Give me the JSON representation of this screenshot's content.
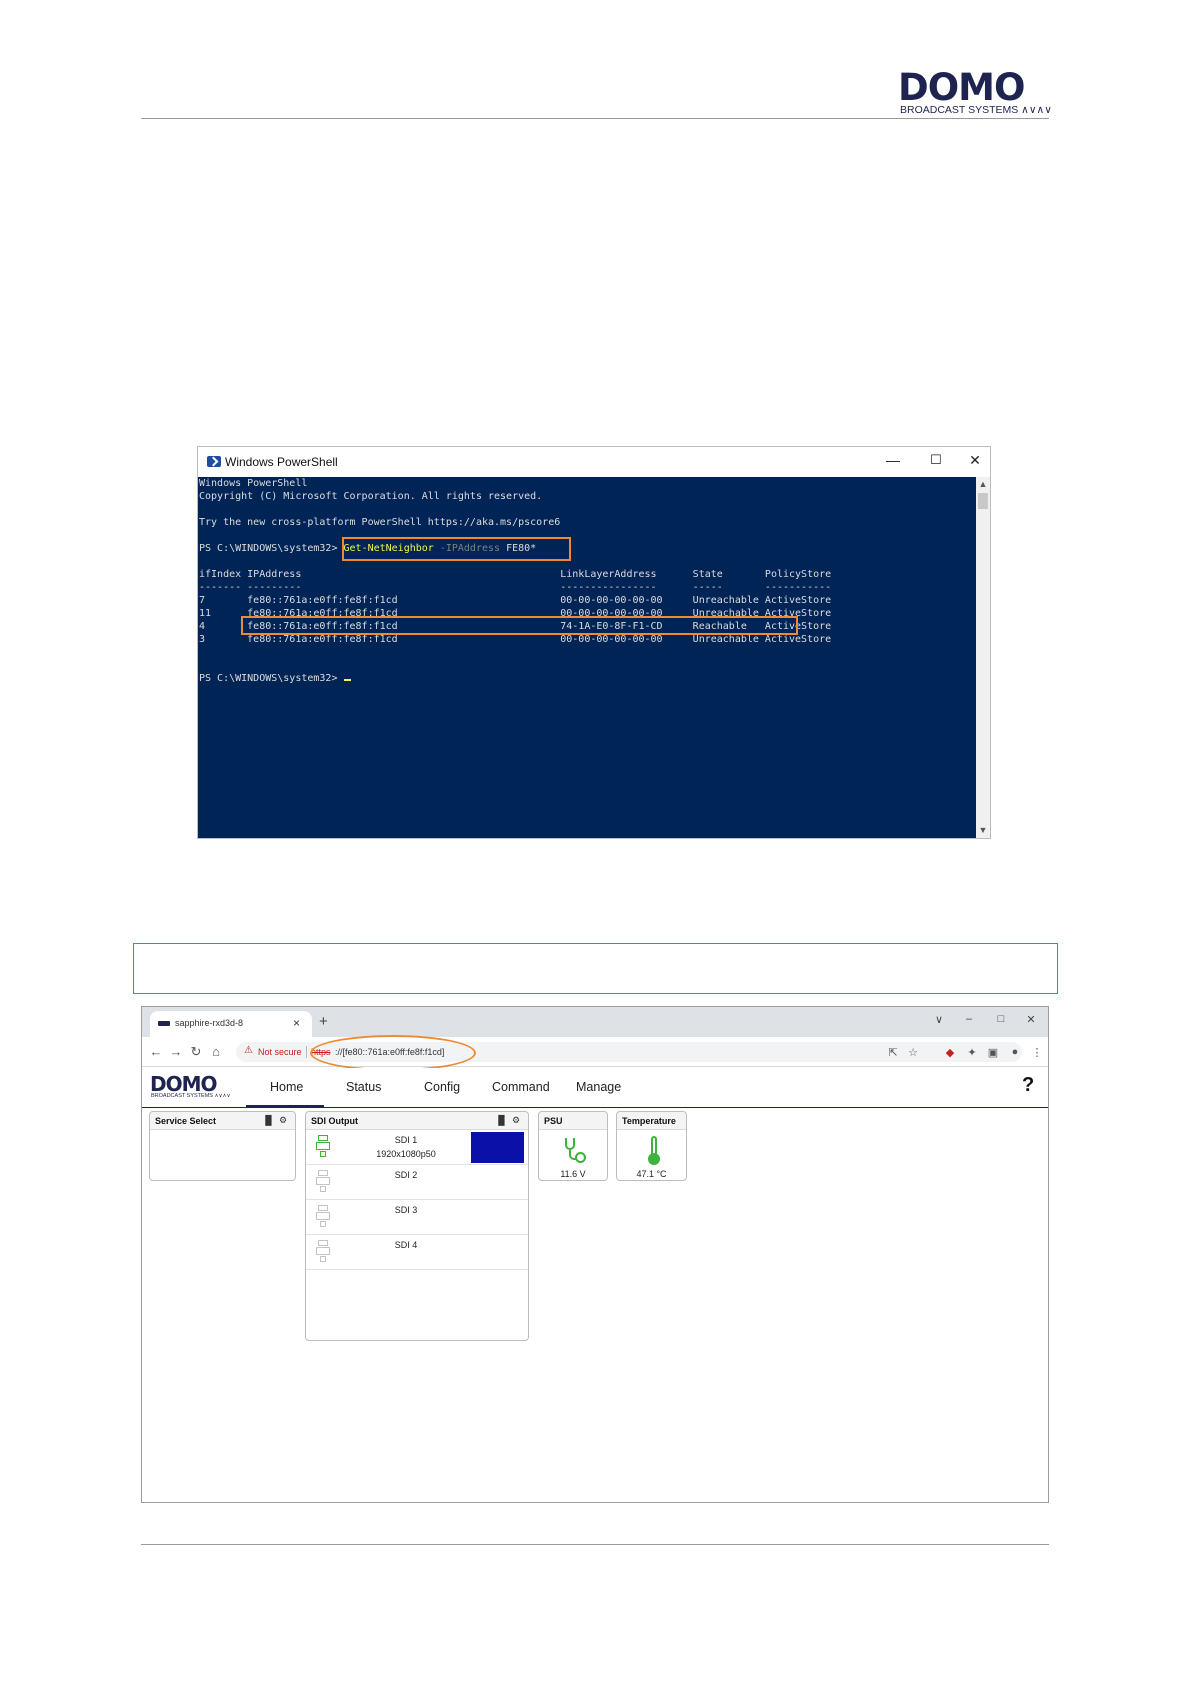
{
  "doc": {
    "logo_word": "DOMO",
    "logo_sub": "BROADCAST SYSTEMS ∧∨∧∨"
  },
  "powershell": {
    "title": "Windows PowerShell",
    "controls": [
      "—",
      "☐",
      "✕"
    ],
    "lines": {
      "banner1": "Windows PowerShell",
      "banner2": "Copyright (C) Microsoft Corporation. All rights reserved.",
      "tryline": "Try the new cross-platform PowerShell https://aka.ms/pscore6",
      "prompt1": "PS C:\\WINDOWS\\system32> ",
      "cmd": "Get-NetNeighbor",
      "param": " -IPAddress",
      "arg": " FE80*",
      "header": "ifIndex IPAddress                                           LinkLayerAddress      State       PolicyStore",
      "dashes": "------- ---------                                           ----------------      -----       -----------",
      "prompt2": "PS C:\\WINDOWS\\system32> "
    },
    "rows": [
      "7       fe80::761a:e0ff:fe8f:f1cd                           00-00-00-00-00-00     Unreachable ActiveStore",
      "11      fe80::761a:e0ff:fe8f:f1cd                           00-00-00-00-00-00     Unreachable ActiveStore",
      "4       fe80::761a:e0ff:fe8f:f1cd                           74-1A-E0-8F-F1-CD     Reachable   ActiveStore",
      "3       fe80::761a:e0ff:fe8f:f1cd                           00-00-00-00-00-00     Unreachable ActiveStore"
    ]
  },
  "browser": {
    "tab_title": "sapphire-rxd3d-8",
    "tab_close": "×",
    "new_tab": "+",
    "win_controls": [
      "∨",
      "–",
      "□",
      "✕"
    ],
    "nav_icons": [
      "←",
      "→",
      "↻",
      "⌂"
    ],
    "warn_icon": "⚠",
    "not_secure": "Not secure",
    "url_scheme": "https",
    "url_rest": "://[fe80::761a:e0ff:fe8f:f1cd]",
    "toolbar_icons": [
      "⇱",
      "☆",
      "◆",
      "✦",
      "▣",
      "●",
      "⋮"
    ]
  },
  "app": {
    "logo_word": "DOMO",
    "logo_sub": "BROADCAST SYSTEMS ∧∨∧∨",
    "nav": [
      "Home",
      "Status",
      "Config",
      "Command",
      "Manage"
    ],
    "help": "?",
    "panels": {
      "service_select": {
        "title": "Service Select"
      },
      "sdi_output": {
        "title": "SDI Output",
        "rows": [
          {
            "name": "SDI 1",
            "format": "1920x1080p50",
            "active": true
          },
          {
            "name": "SDI 2",
            "format": "",
            "active": false
          },
          {
            "name": "SDI 3",
            "format": "",
            "active": false
          },
          {
            "name": "SDI 4",
            "format": "",
            "active": false
          }
        ]
      },
      "psu": {
        "title": "PSU",
        "value": "11.6 V"
      },
      "temperature": {
        "title": "Temperature",
        "value": "47.1 °C"
      }
    },
    "panel_icons": {
      "signal": "▐▌",
      "gear": "⚙"
    },
    "colors": {
      "brand": "#1e2350",
      "ok": "#3db33d",
      "preview": "#0a10a8",
      "highlight": "#ed8b34"
    }
  }
}
